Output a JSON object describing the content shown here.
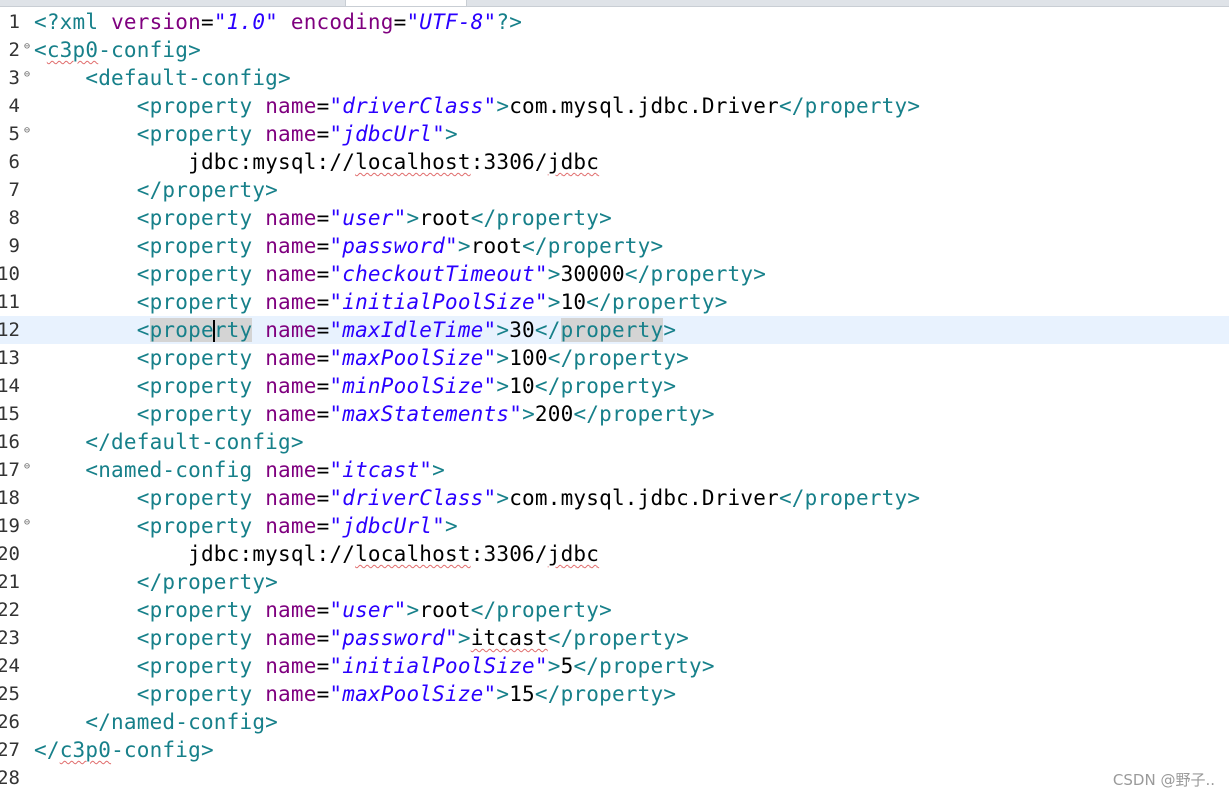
{
  "editor": {
    "current_line": 12,
    "lines": [
      {
        "n": "1",
        "fold": false,
        "indent": "",
        "html": "<span class=\"pi\">&lt;?xml </span><span class=\"attr\">version</span><span class=\"txt\">=</span><span class=\"val\">\"1.0\"</span><span class=\"pi\"> </span><span class=\"attr\">encoding</span><span class=\"txt\">=</span><span class=\"val\">\"UTF-8\"</span><span class=\"pi\">?&gt;</span>"
      },
      {
        "n": "2",
        "fold": true,
        "indent": "",
        "html": "<span class=\"tag\">&lt;<span class=\"spell\">c3p0</span>-config&gt;</span>"
      },
      {
        "n": "3",
        "fold": true,
        "indent": "    ",
        "html": "<span class=\"tag\">&lt;default-config&gt;</span>"
      },
      {
        "n": "4",
        "fold": false,
        "indent": "        ",
        "html": "<span class=\"tag\">&lt;property </span><span class=\"attr\">name</span><span class=\"txt\">=</span><span class=\"val\">\"driverClass\"</span><span class=\"tag\">&gt;</span><span class=\"txt\">com.mysql.jdbc.Driver</span><span class=\"tag\">&lt;/property&gt;</span>"
      },
      {
        "n": "5",
        "fold": true,
        "indent": "        ",
        "html": "<span class=\"tag\">&lt;property </span><span class=\"attr\">name</span><span class=\"txt\">=</span><span class=\"val\">\"jdbcUrl\"</span><span class=\"tag\">&gt;</span>"
      },
      {
        "n": "6",
        "fold": false,
        "indent": "            ",
        "html": "<span class=\"txt\">jdbc:mysql://<span class=\"spell\">localhost</span>:3306/<span class=\"spell\">jdbc</span></span>"
      },
      {
        "n": "7",
        "fold": false,
        "indent": "        ",
        "html": "<span class=\"tag\">&lt;/property&gt;</span>"
      },
      {
        "n": "8",
        "fold": false,
        "indent": "        ",
        "html": "<span class=\"tag\">&lt;property </span><span class=\"attr\">name</span><span class=\"txt\">=</span><span class=\"val\">\"user\"</span><span class=\"tag\">&gt;</span><span class=\"txt\">root</span><span class=\"tag\">&lt;/property&gt;</span>"
      },
      {
        "n": "9",
        "fold": false,
        "indent": "        ",
        "html": "<span class=\"tag\">&lt;property </span><span class=\"attr\">name</span><span class=\"txt\">=</span><span class=\"val\">\"password\"</span><span class=\"tag\">&gt;</span><span class=\"txt\">root</span><span class=\"tag\">&lt;/property&gt;</span>"
      },
      {
        "n": "10",
        "fold": false,
        "indent": "        ",
        "html": "<span class=\"tag\">&lt;property </span><span class=\"attr\">name</span><span class=\"txt\">=</span><span class=\"val\">\"checkoutTimeout\"</span><span class=\"tag\">&gt;</span><span class=\"txt\">30000</span><span class=\"tag\">&lt;/property&gt;</span>"
      },
      {
        "n": "11",
        "fold": false,
        "indent": "        ",
        "html": "<span class=\"tag\">&lt;property </span><span class=\"attr\">name</span><span class=\"txt\">=</span><span class=\"val\">\"initialPoolSize\"</span><span class=\"tag\">&gt;</span><span class=\"txt\">10</span><span class=\"tag\">&lt;/property&gt;</span>"
      },
      {
        "n": "12",
        "fold": false,
        "indent": "        ",
        "html": "<span class=\"tag\">&lt;<span class=\"hl\">prope<span class=\"caret\"></span>rty</span> </span><span class=\"attr\">name</span><span class=\"txt\">=</span><span class=\"val\">\"maxIdleTime\"</span><span class=\"tag\">&gt;</span><span class=\"txt\">30</span><span class=\"tag\">&lt;/<span class=\"hl\">property</span>&gt;</span>"
      },
      {
        "n": "13",
        "fold": false,
        "indent": "        ",
        "html": "<span class=\"tag\">&lt;property </span><span class=\"attr\">name</span><span class=\"txt\">=</span><span class=\"val\">\"maxPoolSize\"</span><span class=\"tag\">&gt;</span><span class=\"txt\">100</span><span class=\"tag\">&lt;/property&gt;</span>"
      },
      {
        "n": "14",
        "fold": false,
        "indent": "        ",
        "html": "<span class=\"tag\">&lt;property </span><span class=\"attr\">name</span><span class=\"txt\">=</span><span class=\"val\">\"minPoolSize\"</span><span class=\"tag\">&gt;</span><span class=\"txt\">10</span><span class=\"tag\">&lt;/property&gt;</span>"
      },
      {
        "n": "15",
        "fold": false,
        "indent": "        ",
        "html": "<span class=\"tag\">&lt;property </span><span class=\"attr\">name</span><span class=\"txt\">=</span><span class=\"val\">\"maxStatements\"</span><span class=\"tag\">&gt;</span><span class=\"txt\">200</span><span class=\"tag\">&lt;/property&gt;</span>"
      },
      {
        "n": "16",
        "fold": false,
        "indent": "    ",
        "html": "<span class=\"tag\">&lt;/default-config&gt;</span>"
      },
      {
        "n": "17",
        "fold": true,
        "indent": "    ",
        "html": "<span class=\"tag\">&lt;named-config </span><span class=\"attr\">name</span><span class=\"txt\">=</span><span class=\"val\">\"itcast\"</span><span class=\"tag\">&gt;</span>"
      },
      {
        "n": "18",
        "fold": false,
        "indent": "        ",
        "html": "<span class=\"tag\">&lt;property </span><span class=\"attr\">name</span><span class=\"txt\">=</span><span class=\"val\">\"driverClass\"</span><span class=\"tag\">&gt;</span><span class=\"txt\">com.mysql.jdbc.Driver</span><span class=\"tag\">&lt;/property&gt;</span>"
      },
      {
        "n": "19",
        "fold": true,
        "indent": "        ",
        "html": "<span class=\"tag\">&lt;property </span><span class=\"attr\">name</span><span class=\"txt\">=</span><span class=\"val\">\"jdbcUrl\"</span><span class=\"tag\">&gt;</span>"
      },
      {
        "n": "20",
        "fold": false,
        "indent": "            ",
        "html": "<span class=\"txt\">jdbc:mysql://<span class=\"spell\">localhost</span>:3306/<span class=\"spell\">jdbc</span></span>"
      },
      {
        "n": "21",
        "fold": false,
        "indent": "        ",
        "html": "<span class=\"tag\">&lt;/property&gt;</span>"
      },
      {
        "n": "22",
        "fold": false,
        "indent": "        ",
        "html": "<span class=\"tag\">&lt;property </span><span class=\"attr\">name</span><span class=\"txt\">=</span><span class=\"val\">\"user\"</span><span class=\"tag\">&gt;</span><span class=\"txt\">root</span><span class=\"tag\">&lt;/property&gt;</span>"
      },
      {
        "n": "23",
        "fold": false,
        "indent": "        ",
        "html": "<span class=\"tag\">&lt;property </span><span class=\"attr\">name</span><span class=\"txt\">=</span><span class=\"val\">\"password\"</span><span class=\"tag\">&gt;</span><span class=\"txt\"><span class=\"spell\">itcast</span></span><span class=\"tag\">&lt;/property&gt;</span>"
      },
      {
        "n": "24",
        "fold": false,
        "indent": "        ",
        "html": "<span class=\"tag\">&lt;property </span><span class=\"attr\">name</span><span class=\"txt\">=</span><span class=\"val\">\"initialPoolSize\"</span><span class=\"tag\">&gt;</span><span class=\"txt\">5</span><span class=\"tag\">&lt;/property&gt;</span>"
      },
      {
        "n": "25",
        "fold": false,
        "indent": "        ",
        "html": "<span class=\"tag\">&lt;property </span><span class=\"attr\">name</span><span class=\"txt\">=</span><span class=\"val\">\"maxPoolSize\"</span><span class=\"tag\">&gt;</span><span class=\"txt\">15</span><span class=\"tag\">&lt;/property&gt;</span>"
      },
      {
        "n": "26",
        "fold": false,
        "indent": "    ",
        "html": "<span class=\"tag\">&lt;/named-config&gt;</span>"
      },
      {
        "n": "27",
        "fold": false,
        "indent": "",
        "html": "<span class=\"tag\">&lt;/<span class=\"spell\">c3p0</span>-config&gt;</span>"
      },
      {
        "n": "28",
        "fold": false,
        "indent": "",
        "html": ""
      }
    ]
  },
  "watermark": "CSDN @野子.."
}
